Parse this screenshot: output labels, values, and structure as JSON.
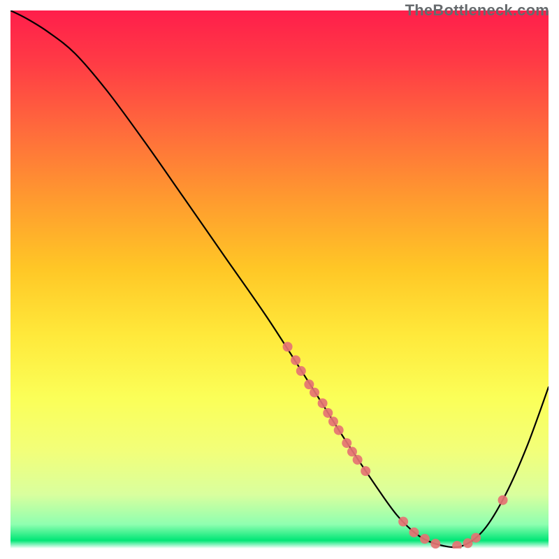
{
  "watermark": "TheBottleneck.com",
  "chart_data": {
    "type": "line",
    "title": "",
    "xlabel": "",
    "ylabel": "",
    "xlim": [
      0,
      100
    ],
    "ylim": [
      0,
      100
    ],
    "grid": false,
    "series": [
      {
        "name": "curve",
        "color": "#000000",
        "x": [
          0,
          3,
          7,
          12,
          18,
          25,
          32,
          40,
          48,
          56,
          62,
          68,
          72,
          76,
          80,
          84,
          88,
          92,
          96,
          100
        ],
        "y": [
          100,
          98.5,
          96,
          92,
          85,
          75.5,
          65.5,
          54,
          42.5,
          30,
          20.5,
          11.5,
          6,
          2.3,
          0.6,
          0.5,
          3.5,
          10,
          19,
          30
        ]
      }
    ],
    "scatter": {
      "name": "points",
      "color": "#e57373",
      "radius": 7,
      "points": [
        {
          "x": 51.5,
          "y": 37.5
        },
        {
          "x": 53.0,
          "y": 35.0
        },
        {
          "x": 54.0,
          "y": 33.0
        },
        {
          "x": 55.5,
          "y": 30.5
        },
        {
          "x": 56.5,
          "y": 29.0
        },
        {
          "x": 58.0,
          "y": 27.0
        },
        {
          "x": 59.0,
          "y": 25.2
        },
        {
          "x": 60.0,
          "y": 23.6
        },
        {
          "x": 61.0,
          "y": 22.0
        },
        {
          "x": 62.5,
          "y": 19.6
        },
        {
          "x": 63.5,
          "y": 18.0
        },
        {
          "x": 64.5,
          "y": 16.5
        },
        {
          "x": 66.0,
          "y": 14.4
        },
        {
          "x": 73.0,
          "y": 5.0
        },
        {
          "x": 75.0,
          "y": 3.0
        },
        {
          "x": 77.0,
          "y": 1.8
        },
        {
          "x": 79.0,
          "y": 0.9
        },
        {
          "x": 83.0,
          "y": 0.5
        },
        {
          "x": 85.0,
          "y": 1.0
        },
        {
          "x": 86.5,
          "y": 2.0
        },
        {
          "x": 91.5,
          "y": 9.0
        }
      ]
    },
    "background_gradient": {
      "type": "vertical",
      "stops": [
        {
          "pos": 0.0,
          "color": "#ff1e4b"
        },
        {
          "pos": 0.1,
          "color": "#ff3c45"
        },
        {
          "pos": 0.22,
          "color": "#ff6a3c"
        },
        {
          "pos": 0.35,
          "color": "#ff9a2f"
        },
        {
          "pos": 0.48,
          "color": "#ffc726"
        },
        {
          "pos": 0.6,
          "color": "#ffe83a"
        },
        {
          "pos": 0.72,
          "color": "#fbff58"
        },
        {
          "pos": 0.82,
          "color": "#f2ff7a"
        },
        {
          "pos": 0.9,
          "color": "#d9ff9e"
        },
        {
          "pos": 0.955,
          "color": "#8fffb0"
        },
        {
          "pos": 0.985,
          "color": "#00e676"
        },
        {
          "pos": 1.0,
          "color": "#ffffff"
        }
      ]
    }
  }
}
